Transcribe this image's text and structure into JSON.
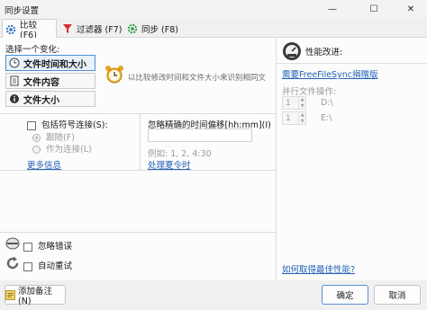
{
  "window": {
    "title": "同步设置",
    "minimize": "—",
    "maximize": "☐",
    "close": "✕"
  },
  "tabs": [
    {
      "label": "比较 (F6)",
      "icon": "gear-icon"
    },
    {
      "label": "过滤器 (F7)",
      "icon": "filter-icon"
    },
    {
      "label": "同步 (F8)",
      "icon": "sync-gear-icon"
    }
  ],
  "compare": {
    "variant_heading": "选择一个变化:",
    "variants": [
      {
        "label": "文件时间和大小",
        "icon": "clock-icon",
        "selected": true
      },
      {
        "label": "文件内容",
        "icon": "document-icon",
        "selected": false
      },
      {
        "label": "文件大小",
        "icon": "info-icon",
        "selected": false
      }
    ],
    "description": "以比较修改时间和文件大小来识别相同文",
    "symlinks": {
      "checkbox_label": "包括符号连接(S):",
      "radio_follow": "跟随(F)",
      "radio_as_link": "作为连接(L)",
      "more_info": "更多信息"
    },
    "ignore_time": {
      "label": "忽略精确的时间偏移[hh:mm](I)",
      "value": "",
      "example": "例如: 1, 2, 4:30",
      "dst_link": "处理夏令时"
    },
    "ignore_errors": "忽略错误",
    "auto_retry": "自动重试"
  },
  "performance": {
    "title": "性能改进:",
    "donate_link": "需要FreeFileSync捐赠版",
    "parallel_label": "并行文件操作:",
    "rows": [
      {
        "count": "1",
        "drive": "D:\\"
      },
      {
        "count": "1",
        "drive": "E:\\"
      }
    ],
    "best_perf_link": "如何取得最佳性能?"
  },
  "footer": {
    "add_note": "添加备注(N)",
    "ok": "确定",
    "cancel": "取消"
  },
  "colors": {
    "accent": "#2362b8",
    "selected_border": "#4a90d9"
  }
}
